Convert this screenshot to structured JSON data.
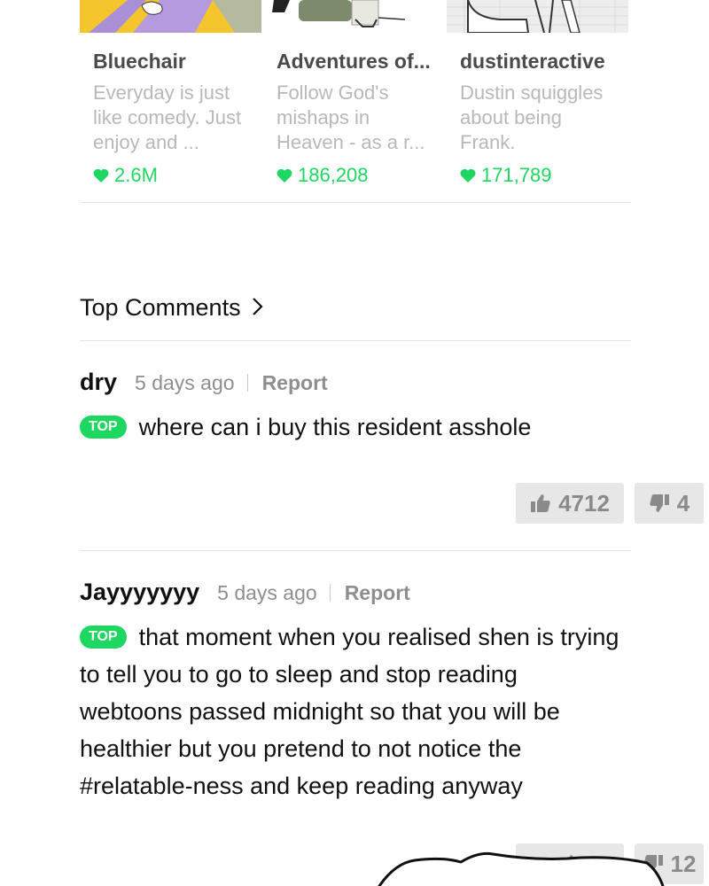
{
  "recommendations": [
    {
      "title": "Bluechair",
      "description": "Everyday is just like comedy. Just enjoy and ...",
      "likes": "2.6M",
      "thumb_color": "#f5c52e",
      "accent_color": "#a990d6"
    },
    {
      "title": "Adventures of...",
      "description": "Follow God's mishaps in Heaven - as a r...",
      "likes": "186,208",
      "thumb_color": "#ffffff",
      "accent_color": "#7d8a6b"
    },
    {
      "title": "dustinteractive",
      "description": "Dustin squiggles about being Frank.",
      "likes": "171,789",
      "thumb_color": "#e9e9e9",
      "accent_color": "#555555"
    }
  ],
  "top_comments": {
    "label": "Top Comments",
    "icon": "chevron-right-icon"
  },
  "comments": [
    {
      "author": "dry",
      "time": "5 days ago",
      "report": "Report",
      "badge": "TOP",
      "text": "where can i buy this resident asshole",
      "upvotes": "4712",
      "downvotes": "4"
    },
    {
      "author": "Jayyyyyyy",
      "time": "5 days ago",
      "report": "Report",
      "badge": "TOP",
      "text": "that moment when you realised shen is trying to tell you to go to sleep and stop reading webtoons passed midnight so that you will be healthier but you pretend to not notice the #relatable-ness and keep reading anyway",
      "downvotes_partial": "12"
    }
  ],
  "colors": {
    "accent_green": "#1ed760",
    "muted_text": "#8e8e8e",
    "vote_bg": "#e7e7e7"
  }
}
